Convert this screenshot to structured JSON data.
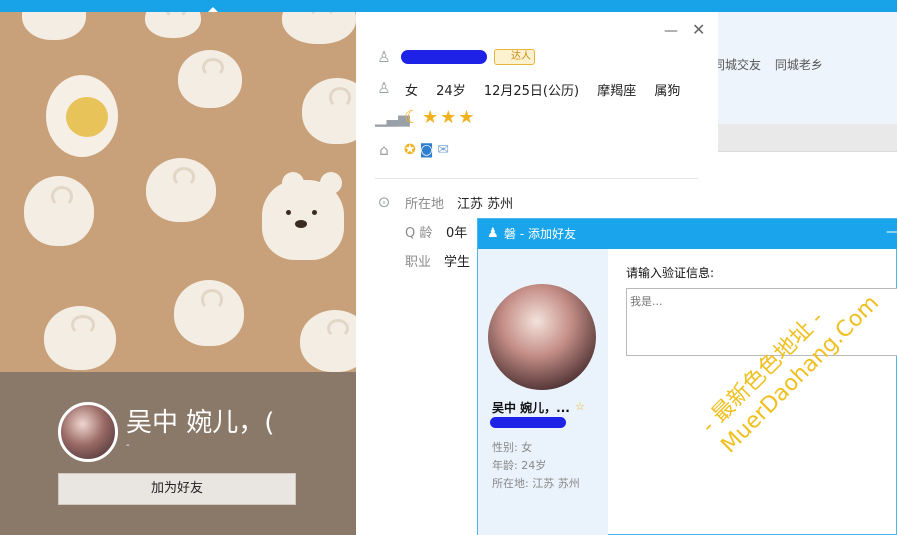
{
  "background_window": {
    "links": [
      "同城交友",
      "同城老乡"
    ]
  },
  "profile_card": {
    "display_name": "吴中  婉儿，(",
    "sub_line": "-",
    "add_friend_button": "加为好友"
  },
  "info_panel": {
    "badge": "达人",
    "gender": "女",
    "age": "24岁",
    "birthday": "12月25日(公历)",
    "zodiac": "摩羯座",
    "chinese_zodiac": "属狗",
    "level_icons": [
      "moon-icon",
      "star-icon",
      "star-icon",
      "star-icon"
    ],
    "service_icons": [
      "star-icon",
      "camera-icon",
      "mail-icon"
    ],
    "details": [
      {
        "label": "所在地",
        "value": "江苏 苏州"
      },
      {
        "label": "Q 龄",
        "value": "0年"
      },
      {
        "label": "职业",
        "value": "学生"
      }
    ]
  },
  "dialog": {
    "title": "磐 - 添加好友",
    "name": "吴中  婉儿，...",
    "info": [
      "性别: 女",
      "年龄: 24岁",
      "所在地: 江苏  苏州"
    ],
    "verify_label": "请输入验证信息:",
    "verify_placeholder": "我是..."
  },
  "watermark": {
    "lines": [
      "- 最新色色地址 -",
      "MuerDaohang.Com"
    ]
  },
  "colors": {
    "title_bar": "#1aa4ec",
    "cover": "#c8a07a",
    "card_bottom": "#8a7968",
    "redaction": "#1e22e6",
    "watermark": "#f0c020"
  }
}
